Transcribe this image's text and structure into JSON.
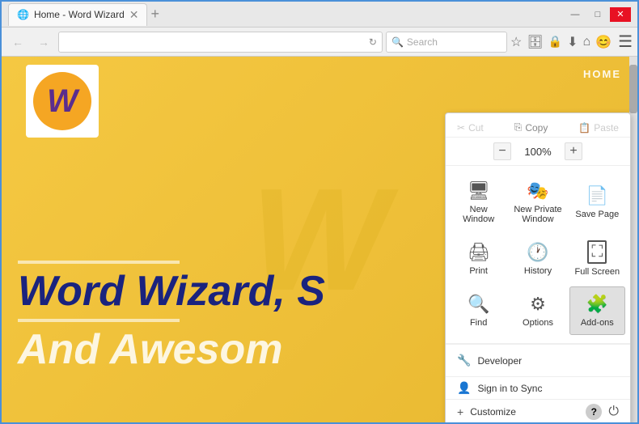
{
  "window": {
    "title": "Home - Word Wizard",
    "controls": {
      "minimize": "—",
      "maximize": "□",
      "close": "✕"
    }
  },
  "tabs": [
    {
      "label": "Home - Word Wizard",
      "active": true
    }
  ],
  "nav": {
    "back_disabled": true,
    "forward_disabled": true,
    "address": "",
    "search_placeholder": "Search"
  },
  "toolbar_icons": [
    "⭐",
    "🗄",
    "🔒",
    "⬇",
    "🏠",
    "😊",
    "☰"
  ],
  "page": {
    "nav_links": "HOME",
    "hero_title": "Word Wizard, S",
    "hero_subtitle": "And Awesom",
    "logo_letter": "W"
  },
  "menu": {
    "cut_label": "Cut",
    "copy_label": "Copy",
    "paste_label": "Paste",
    "zoom_label": "100%",
    "zoom_minus": "−",
    "zoom_plus": "+",
    "items": [
      {
        "id": "new-window",
        "label": "New Window",
        "icon": "🖥"
      },
      {
        "id": "new-private",
        "label": "New Private\nWindow",
        "icon": "🎭"
      },
      {
        "id": "save-page",
        "label": "Save Page",
        "icon": "📄"
      },
      {
        "id": "print",
        "label": "Print",
        "icon": "🖨"
      },
      {
        "id": "history",
        "label": "History",
        "icon": "🕐"
      },
      {
        "id": "full-screen",
        "label": "Full Screen",
        "icon": "⛶"
      },
      {
        "id": "find",
        "label": "Find",
        "icon": "🔍"
      },
      {
        "id": "options",
        "label": "Options",
        "icon": "⚙"
      },
      {
        "id": "add-ons",
        "label": "Add-ons",
        "icon": "🧩"
      }
    ],
    "developer_label": "Developer",
    "sync_label": "Sign in to Sync",
    "customize_label": "Customize",
    "help_icon": "?",
    "power_icon": "⏻"
  }
}
